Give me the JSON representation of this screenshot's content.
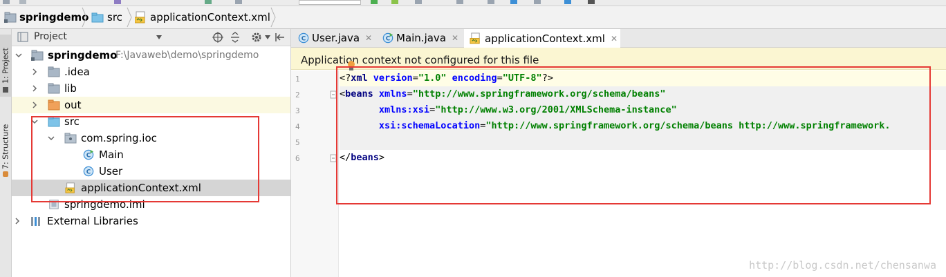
{
  "breadcrumb": [
    "springdemo",
    "src",
    "applicationContext.xml"
  ],
  "side_tabs": {
    "project": "1: Project",
    "structure": "7: Structure"
  },
  "project_panel": {
    "title": "Project"
  },
  "tree": [
    {
      "label": "springdemo",
      "path": "F:\\Javaweb\\demo\\springdemo"
    },
    {
      "label": ".idea"
    },
    {
      "label": "lib"
    },
    {
      "label": "out"
    },
    {
      "label": "src"
    },
    {
      "label": "com.spring.ioc"
    },
    {
      "label": "Main"
    },
    {
      "label": "User"
    },
    {
      "label": "applicationContext.xml"
    },
    {
      "label": "springdemo.iml"
    },
    {
      "label": "External Libraries"
    }
  ],
  "editor": {
    "tabs": [
      {
        "label": "User.java"
      },
      {
        "label": "Main.java"
      },
      {
        "label": "applicationContext.xml"
      }
    ],
    "banner": "Application context not configured for this file",
    "line_numbers": [
      "1",
      "2",
      "3",
      "4",
      "5",
      "6"
    ],
    "code": {
      "l1": [
        "<?",
        "xml ",
        "version",
        "=",
        "\"1.0\"",
        " ",
        "encoding",
        "=",
        "\"UTF-8\"",
        "?>"
      ],
      "l2": [
        "<",
        "beans ",
        "xmlns",
        "=",
        "\"http://www.springframework.org/schema/beans\""
      ],
      "l3": [
        "       ",
        "xmlns:xsi",
        "=",
        "\"http://www.w3.org/2001/XMLSchema-instance\""
      ],
      "l4": [
        "       ",
        "xsi:schemaLocation",
        "=",
        "\"http://www.springframework.org/schema/beans http://www.springframework."
      ],
      "l6": [
        "</",
        "beans",
        ">"
      ]
    }
  },
  "watermark": "http://blog.csdn.net/chensanwa",
  "colors": {
    "highlight": "#e53935",
    "banner": "#fbf6d2",
    "java_class": "#3d8fd6",
    "xml_tag": "#000080",
    "xml_attr": "#0000ff",
    "xml_value": "#008000"
  }
}
